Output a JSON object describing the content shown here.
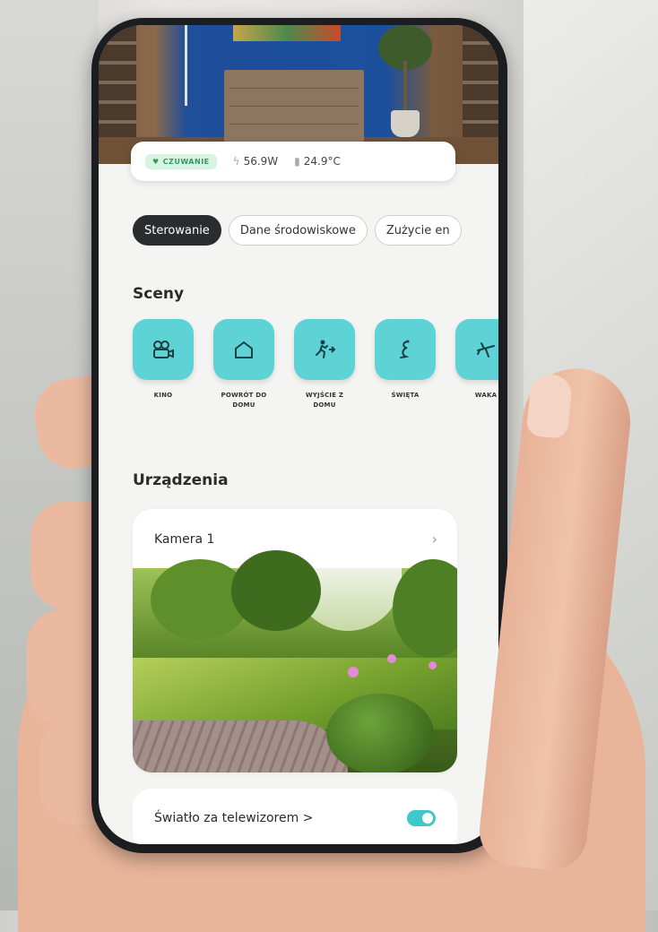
{
  "status": {
    "badge": "CZUWANIE",
    "power": "56.9W",
    "temperature": "24.9°C"
  },
  "tabs": [
    "Sterowanie",
    "Dane środowiskowe",
    "Zużycie en"
  ],
  "scenes": {
    "title": "Sceny",
    "items": [
      {
        "label": "KINO",
        "icon": "camera-icon"
      },
      {
        "label": "POWRÓT DO DOMU",
        "icon": "house-icon"
      },
      {
        "label": "WYJŚCIE Z DOMU",
        "icon": "walking-out-icon"
      },
      {
        "label": "ŚWIĘTA",
        "icon": "christmas-icon"
      },
      {
        "label": "WAKA",
        "icon": "plane-icon"
      }
    ]
  },
  "devices": {
    "title": "Urządzenia",
    "camera": {
      "name": "Kamera 1"
    },
    "light": {
      "name": "Światło za telewizorem >",
      "on": true
    }
  },
  "colors": {
    "accent": "#5ed3d5",
    "active_tab": "#2a2c2e",
    "toggle": "#3fc7c9"
  }
}
